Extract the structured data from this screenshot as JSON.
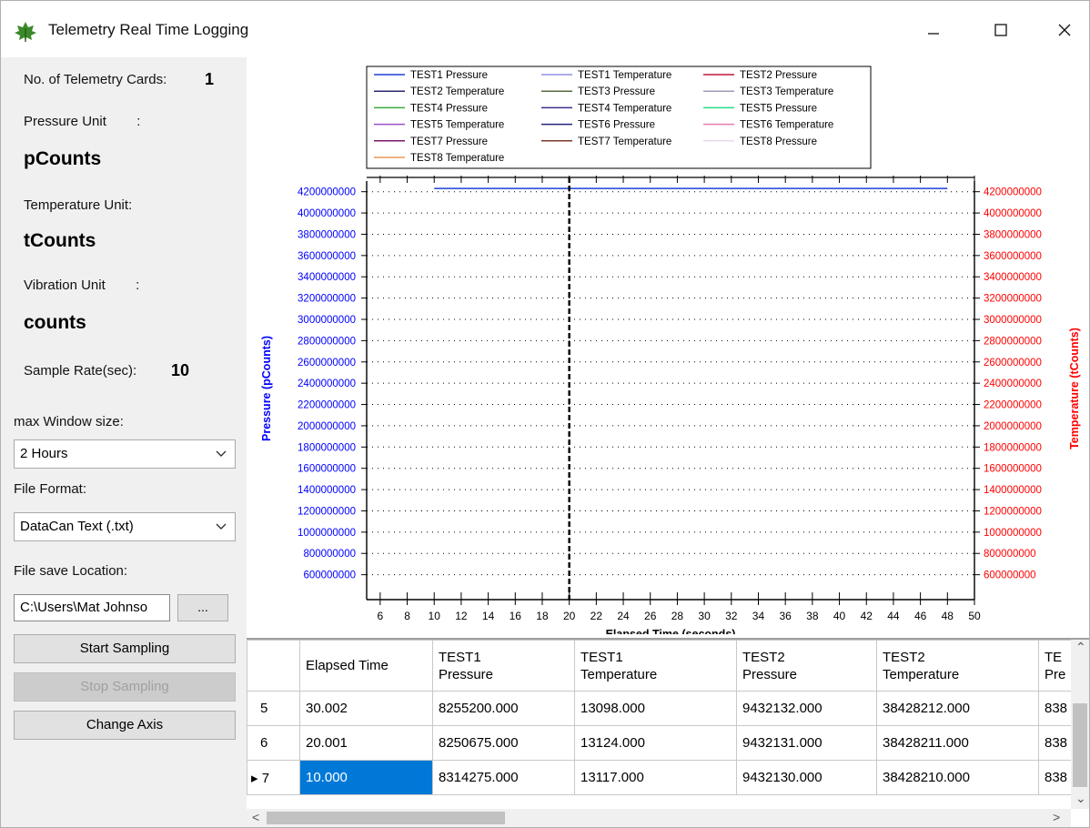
{
  "window": {
    "title": "Telemetry Real Time Logging",
    "icon": "leaf-app-icon",
    "controls": [
      "minimize-icon",
      "maximize-icon",
      "close-icon"
    ]
  },
  "left_panel": {
    "cards_label": "No. of Telemetry Cards:",
    "cards_value": "1",
    "pressure_unit_label": "Pressure Unit        :",
    "pressure_unit_value": "pCounts",
    "temperature_unit_label": "Temperature Unit:",
    "temperature_unit_value": "tCounts",
    "vibration_unit_label": "Vibration Unit        :",
    "vibration_unit_value": "counts",
    "sample_rate_label": "Sample Rate(sec):",
    "sample_rate_value": "10",
    "max_window_label": "max Window size:",
    "max_window_value": "2 Hours",
    "file_format_label": "File Format:",
    "file_format_value": "DataCan Text (.txt)",
    "save_location_label": "File save Location:",
    "save_location_value": "C:\\Users\\Mat Johnso",
    "browse_label": "...",
    "start_label": "Start Sampling",
    "stop_label": "Stop Sampling",
    "change_axis_label": "Change Axis"
  },
  "chart_data": {
    "type": "line",
    "xlabel": "Elapsed Time (seconds)",
    "ylabel_left": "Pressure (pCounts)",
    "ylabel_right": "Temperature (tCounts)",
    "xlim": [
      5,
      50
    ],
    "ylim": [
      400000000,
      4300000000
    ],
    "x_ticks": [
      6,
      8,
      10,
      12,
      14,
      16,
      18,
      20,
      22,
      24,
      26,
      28,
      30,
      32,
      34,
      36,
      38,
      40,
      42,
      44,
      46,
      48,
      50
    ],
    "y_ticks": [
      600000000,
      800000000,
      1000000000,
      1200000000,
      1400000000,
      1600000000,
      1800000000,
      2000000000,
      2200000000,
      2400000000,
      2600000000,
      2800000000,
      3000000000,
      3200000000,
      3400000000,
      3600000000,
      3800000000,
      4000000000,
      4200000000
    ],
    "grid": true,
    "legend_position": "top",
    "left_axis_color": "#0000ff",
    "right_axis_color": "#ff0000",
    "series": [
      {
        "name": "TEST1 Pressure",
        "color": "#1f3fd8"
      },
      {
        "name": "TEST1 Temperature",
        "color": "#8f8fe8"
      },
      {
        "name": "TEST2 Pressure",
        "color": "#c0143c"
      },
      {
        "name": "TEST2 Temperature",
        "color": "#28286e"
      },
      {
        "name": "TEST3 Pressure",
        "color": "#5a6b3c"
      },
      {
        "name": "TEST3 Temperature",
        "color": "#a09cb8"
      },
      {
        "name": "TEST4 Pressure",
        "color": "#3caa3c"
      },
      {
        "name": "TEST4 Temperature",
        "color": "#3c2c8c"
      },
      {
        "name": "TEST5 Pressure",
        "color": "#22dd88"
      },
      {
        "name": "TEST5 Temperature",
        "color": "#9a4fc8"
      },
      {
        "name": "TEST6 Pressure",
        "color": "#23237a"
      },
      {
        "name": "TEST6 Temperature",
        "color": "#e87ab0"
      },
      {
        "name": "TEST7 Pressure",
        "color": "#7a1a6a"
      },
      {
        "name": "TEST7 Temperature",
        "color": "#7a3a2a"
      },
      {
        "name": "TEST8 Pressure",
        "color": "#e8d8ec"
      },
      {
        "name": "TEST8 Temperature",
        "color": "#e89a5a"
      }
    ],
    "data_lines": [
      {
        "name": "TEST1 Pressure",
        "color": "#1f3fd8",
        "x": [
          10,
          48
        ],
        "y": [
          4230000000,
          4230000000
        ]
      }
    ],
    "cursor_x": 20
  },
  "table": {
    "columns": [
      "",
      "Elapsed Time",
      "TEST1\nPressure",
      "TEST1\nTemperature",
      "TEST2\nPressure",
      "TEST2\nTemperature",
      "TE\nPre"
    ],
    "rows": [
      [
        "5",
        "30.002",
        "8255200.000",
        "13098.000",
        "9432132.000",
        "38428212.000",
        "838"
      ],
      [
        "6",
        "20.001",
        "8250675.000",
        "13124.000",
        "9432131.000",
        "38428211.000",
        "838"
      ],
      [
        "7",
        "10.000",
        "8314275.000",
        "13117.000",
        "9432130.000",
        "38428210.000",
        "838"
      ]
    ],
    "current_row_marker": "▸",
    "selected_row": 2,
    "selected_col": 1
  }
}
